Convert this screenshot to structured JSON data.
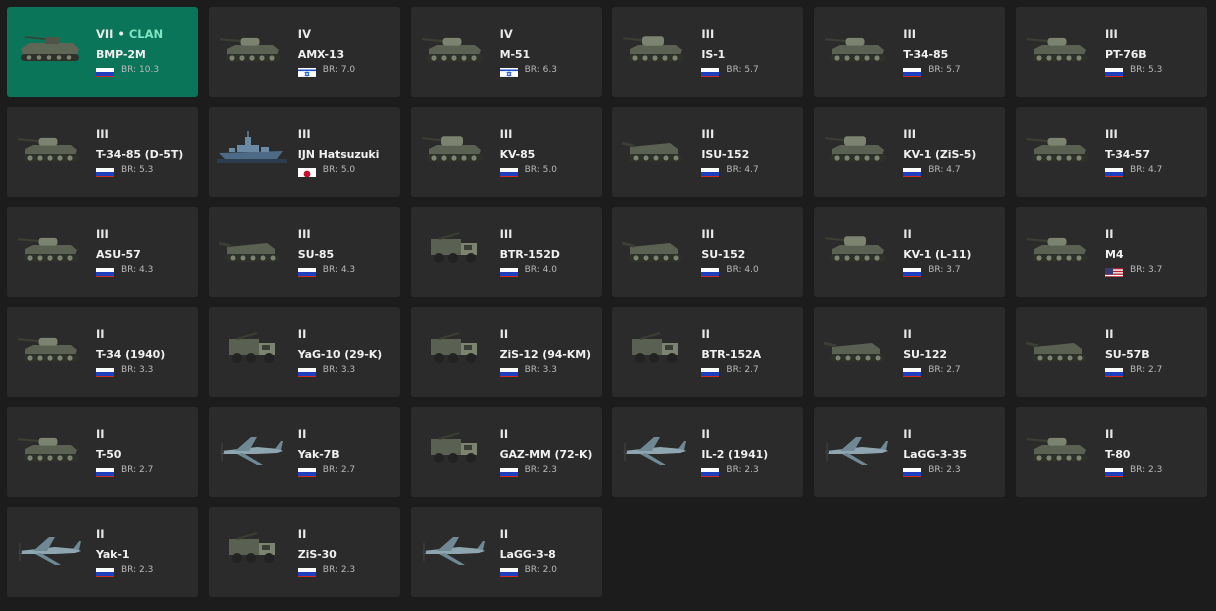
{
  "vehicles": [
    {
      "rank": "VII",
      "clan": "CLAN",
      "separator": " • ",
      "name": "BMP-2M",
      "country": "ussr",
      "br": "BR: 10.3",
      "type": "ifv",
      "selected": true
    },
    {
      "rank": "IV",
      "name": "AMX-13",
      "name_prefix": "",
      "country": "israel",
      "br": "BR: 7.0",
      "type": "light-tank"
    },
    {
      "rank": "IV",
      "name": "M-51",
      "country": "israel",
      "br": "BR: 6.3",
      "type": "tank"
    },
    {
      "rank": "III",
      "name": "IS-1",
      "country": "ussr",
      "br": "BR: 5.7",
      "type": "heavy-tank"
    },
    {
      "rank": "III",
      "name": "T-34-85",
      "country": "ussr",
      "br": "BR: 5.7",
      "type": "tank"
    },
    {
      "rank": "III",
      "name": "PT-76B",
      "country": "ussr",
      "br": "BR: 5.3",
      "type": "light-tank"
    },
    {
      "rank": "III",
      "name": "T-34-85 (D-5T)",
      "country": "ussr",
      "br": "BR: 5.3",
      "type": "tank"
    },
    {
      "rank": "III",
      "name": "IJN Hatsuzuki",
      "country": "japan",
      "br": "BR: 5.0",
      "type": "ship"
    },
    {
      "rank": "III",
      "name": "KV-85",
      "country": "ussr",
      "br": "BR: 5.0",
      "type": "heavy-tank"
    },
    {
      "rank": "III",
      "name": "ISU-152",
      "country": "ussr",
      "br": "BR: 4.7",
      "type": "tank-destroyer"
    },
    {
      "rank": "III",
      "name": "KV-1 (ZiS-5)",
      "country": "ussr",
      "br": "BR: 4.7",
      "type": "heavy-tank"
    },
    {
      "rank": "III",
      "name": "T-34-57",
      "country": "ussr",
      "br": "BR: 4.7",
      "type": "tank"
    },
    {
      "rank": "III",
      "name": "ASU-57",
      "country": "ussr",
      "br": "BR: 4.3",
      "type": "light-tank"
    },
    {
      "rank": "III",
      "name": "SU-85",
      "country": "ussr",
      "br": "BR: 4.3",
      "type": "tank-destroyer"
    },
    {
      "rank": "III",
      "name": "BTR-152D",
      "country": "ussr",
      "br": "BR: 4.0",
      "type": "truck"
    },
    {
      "rank": "III",
      "name": "SU-152",
      "country": "ussr",
      "br": "BR: 4.0",
      "type": "tank-destroyer"
    },
    {
      "rank": "II",
      "name": "KV-1 (L-11)",
      "country": "ussr",
      "br": "BR: 3.7",
      "type": "heavy-tank"
    },
    {
      "rank": "II",
      "name": "M4",
      "country": "usa",
      "br": "BR: 3.7",
      "type": "tank"
    },
    {
      "rank": "II",
      "name": "T-34 (1940)",
      "country": "ussr",
      "br": "BR: 3.3",
      "type": "tank"
    },
    {
      "rank": "II",
      "name": "YaG-10 (29-K)",
      "country": "ussr",
      "br": "BR: 3.3",
      "type": "truck"
    },
    {
      "rank": "II",
      "name": "ZiS-12 (94-KM)",
      "country": "ussr",
      "br": "BR: 3.3",
      "type": "truck"
    },
    {
      "rank": "II",
      "name": "BTR-152A",
      "country": "ussr",
      "br": "BR: 2.7",
      "type": "truck"
    },
    {
      "rank": "II",
      "name": "SU-122",
      "country": "ussr",
      "br": "BR: 2.7",
      "type": "tank-destroyer"
    },
    {
      "rank": "II",
      "name": "SU-57B",
      "country": "ussr",
      "br": "BR: 2.7",
      "type": "tank-destroyer"
    },
    {
      "rank": "II",
      "name": "T-50",
      "country": "ussr",
      "br": "BR: 2.7",
      "type": "light-tank"
    },
    {
      "rank": "II",
      "name": "Yak-7B",
      "country": "ussr",
      "br": "BR: 2.7",
      "type": "plane"
    },
    {
      "rank": "II",
      "name": "GAZ-MM (72-K)",
      "country": "ussr",
      "br": "BR: 2.3",
      "type": "truck"
    },
    {
      "rank": "II",
      "name": "IL-2 (1941)",
      "country": "ussr",
      "br": "BR: 2.3",
      "type": "plane"
    },
    {
      "rank": "II",
      "name": "LaGG-3-35",
      "country": "ussr",
      "br": "BR: 2.3",
      "type": "plane"
    },
    {
      "rank": "II",
      "name": "T-80",
      "country": "ussr",
      "br": "BR: 2.3",
      "type": "light-tank"
    },
    {
      "rank": "II",
      "name": "Yak-1",
      "country": "ussr",
      "br": "BR: 2.3",
      "type": "plane"
    },
    {
      "rank": "II",
      "name": "ZiS-30",
      "country": "ussr",
      "br": "BR: 2.3",
      "type": "truck"
    },
    {
      "rank": "II",
      "name": "LaGG-3-8",
      "country": "ussr",
      "br": "BR: 2.0",
      "type": "plane"
    }
  ],
  "colors": {
    "background": "#1c1c1c",
    "card": "#2b2b2b",
    "selected_card": "#0a7558",
    "clan_text": "#7fe3c4"
  }
}
